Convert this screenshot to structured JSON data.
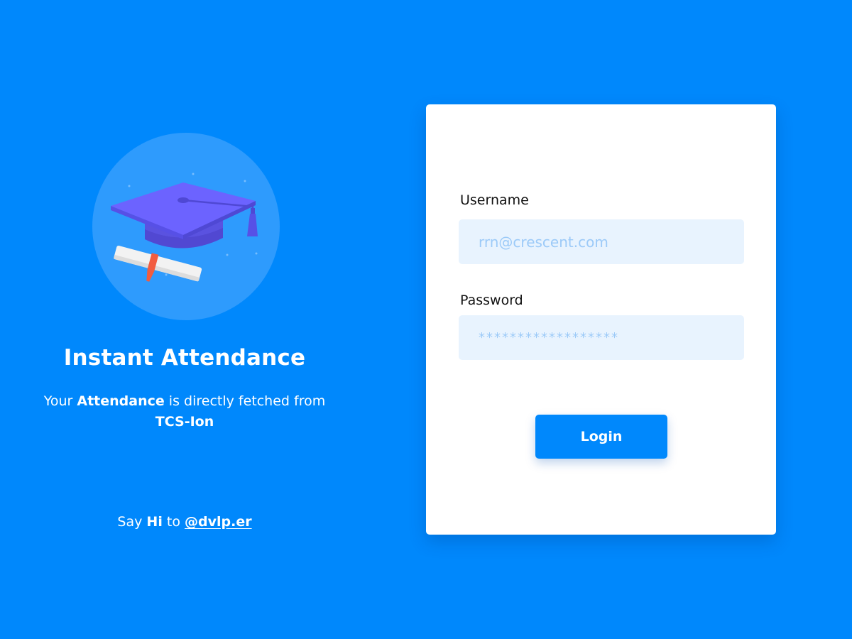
{
  "hero": {
    "icon": "graduation-cap-diploma-icon",
    "title": "Instant Attendance",
    "tagline": {
      "prefix": "Your ",
      "bold1": "Attendance",
      "middle": " is directly fetched from ",
      "bold2": "TCS-Ion"
    },
    "footer": {
      "prefix": "Say ",
      "bold": "Hi",
      "middle": " to ",
      "link": "@dvlp.er"
    }
  },
  "login_form": {
    "username": {
      "label": "Username",
      "placeholder": "rrn@crescent.com"
    },
    "password": {
      "label": "Password",
      "placeholder": "******************"
    },
    "submit_label": "Login"
  },
  "colors": {
    "background": "#0088fc",
    "card": "#ffffff",
    "input_bg": "#e8f3fe",
    "cap": "#6c63ff",
    "button": "#0088fc"
  }
}
